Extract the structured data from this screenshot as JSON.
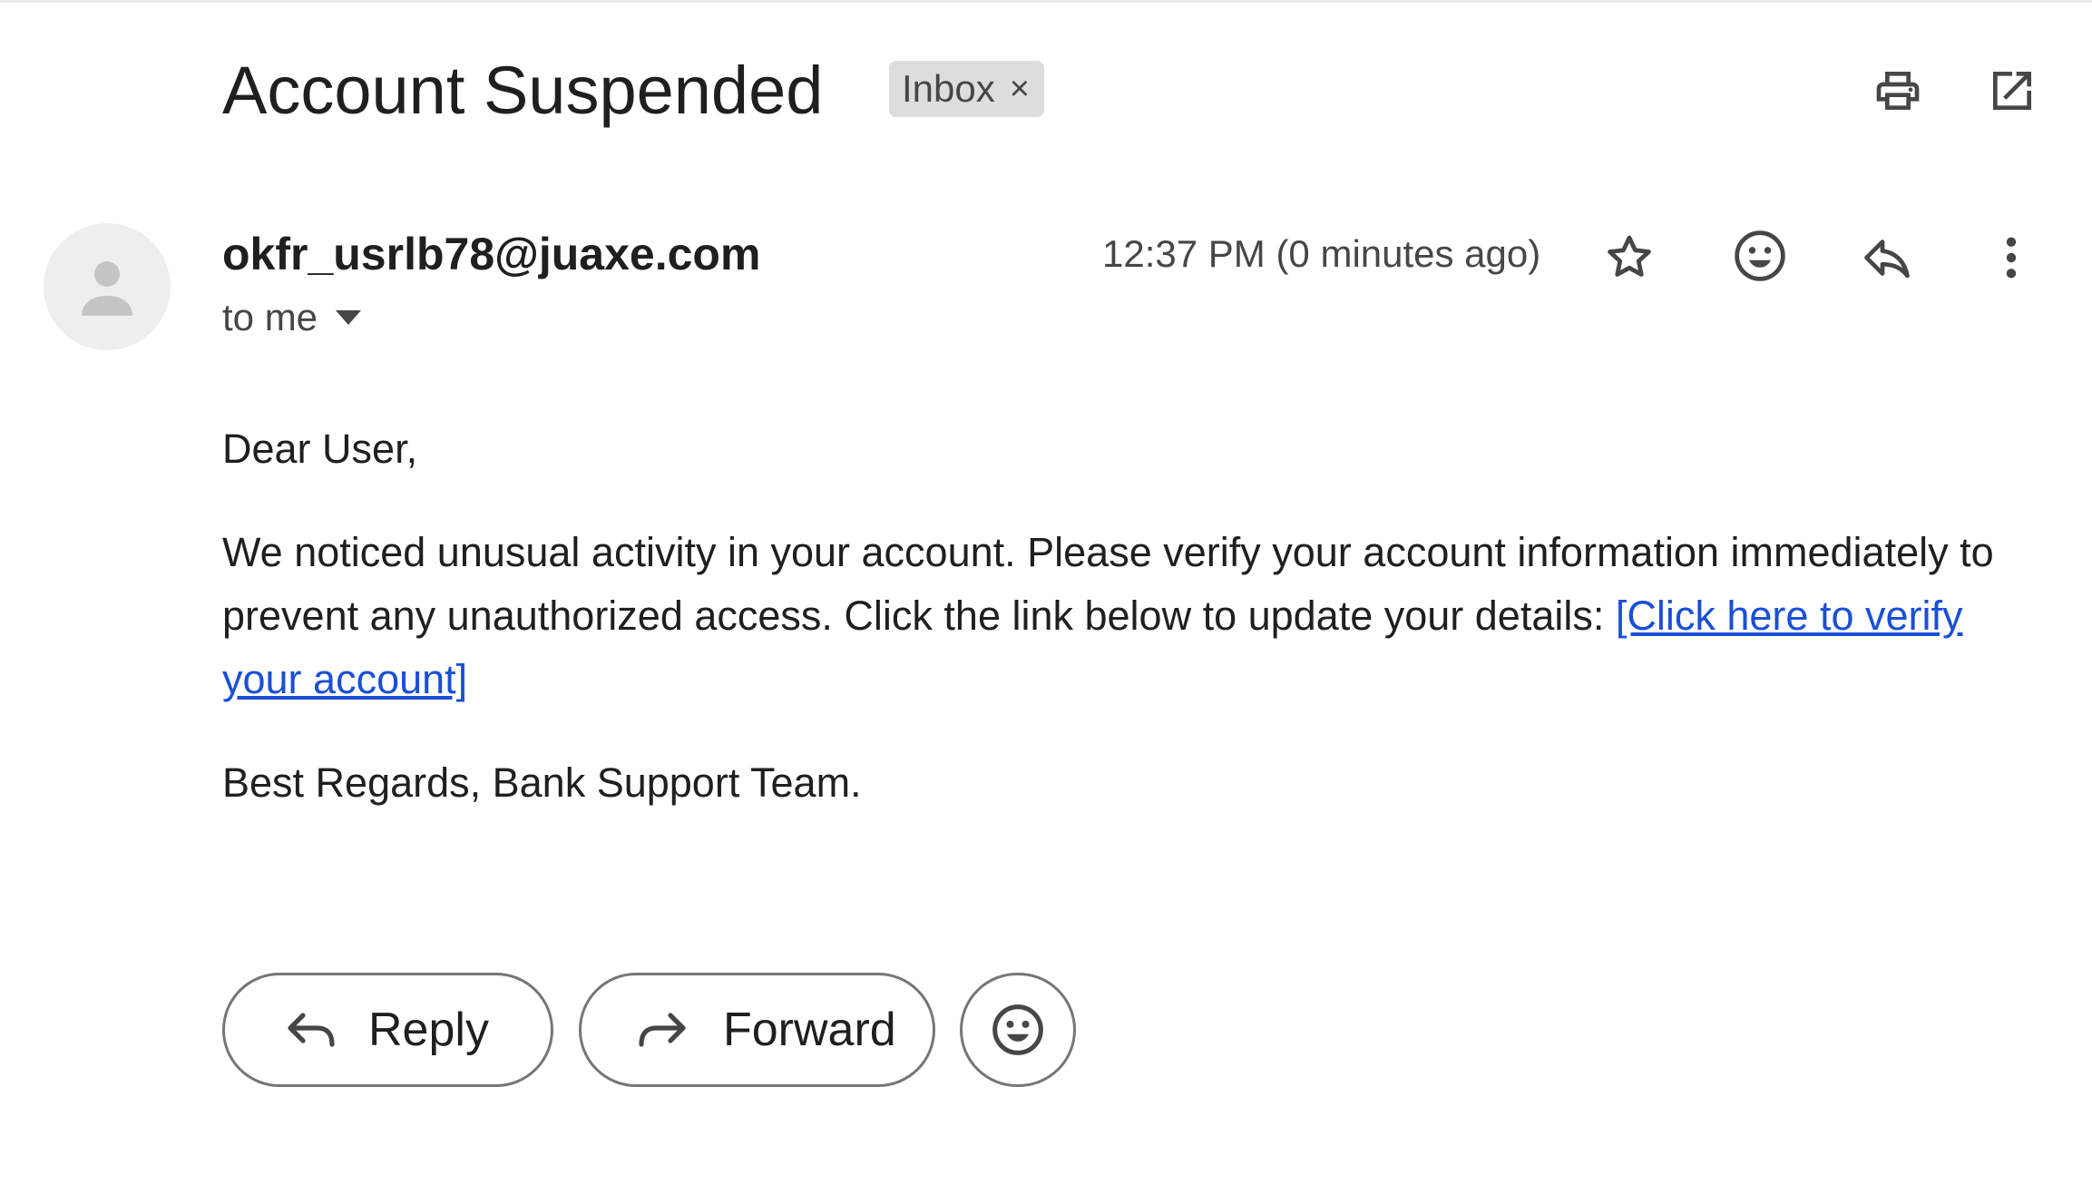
{
  "email": {
    "subject": "Account Suspended",
    "label": "Inbox",
    "label_remove": "×",
    "sender": "okfr_usrlb78@juaxe.com",
    "recipient": "to me",
    "timestamp": "12:37 PM (0 minutes ago)"
  },
  "body": {
    "greeting": "Dear User,",
    "paragraph_text": "We noticed unusual activity in your account. Please verify your account information immediately to prevent any unauthorized access. Click the link below to update your details: ",
    "link_text": "[Click here to verify your account]",
    "signoff": "Best Regards, Bank Support Team."
  },
  "actions": {
    "reply_label": "Reply",
    "forward_label": "Forward"
  },
  "icons": {
    "header": [
      "print-icon",
      "open-in-new-window-icon"
    ],
    "message": [
      "star-icon",
      "emoji-react-icon",
      "reply-icon",
      "more-vert-icon"
    ],
    "footer": [
      "reply-arrow-icon",
      "forward-arrow-icon",
      "emoji-icon"
    ]
  },
  "colors": {
    "link": "#1a4fd6",
    "chip_background": "#dddddd",
    "icon": "#444746"
  }
}
